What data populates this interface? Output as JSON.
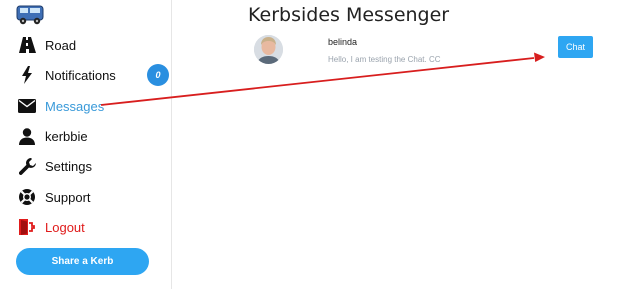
{
  "app": {
    "logo_icon": "truck-logo-icon"
  },
  "nav": {
    "items": [
      {
        "label": "Road",
        "icon": "road-icon"
      },
      {
        "label": "Notifications",
        "icon": "lightning-icon"
      },
      {
        "label": "Messages",
        "icon": "envelope-icon",
        "active": true
      },
      {
        "label": "kerbbie",
        "icon": "user-icon"
      },
      {
        "label": "Settings",
        "icon": "wrench-icon"
      },
      {
        "label": "Support",
        "icon": "lifebuoy-icon"
      },
      {
        "label": "Logout",
        "icon": "logout-door-icon"
      }
    ],
    "notifications_count": "0"
  },
  "share_button": "Share a Kerb",
  "main": {
    "title": "Kerbsides Messenger",
    "conversations": [
      {
        "name": "belinda",
        "preview": "Hello, I am testing the Chat. CC",
        "action": "Chat"
      }
    ]
  },
  "colors": {
    "accent": "#2ea6f2",
    "active": "#3a9ad9",
    "logout": "#e01b1b",
    "annotation": "#d81e1e"
  }
}
